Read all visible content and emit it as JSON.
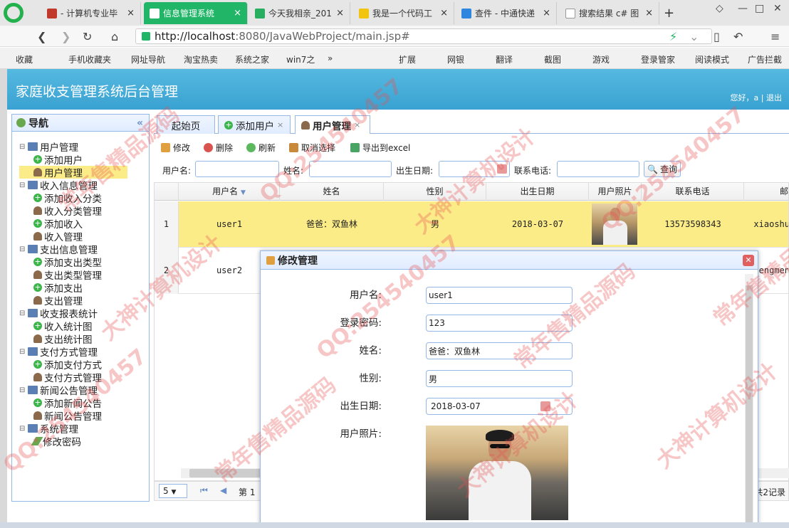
{
  "browser": {
    "tabs": [
      {
        "title": "- 计算机专业毕",
        "active": false
      },
      {
        "title": "信息管理系统",
        "active": true
      },
      {
        "title": "今天我相亲_201",
        "active": false
      },
      {
        "title": "我是一个代码工",
        "active": false
      },
      {
        "title": "查件 - 中通快递",
        "active": false
      },
      {
        "title": "搜索结果 c# 图",
        "active": false
      }
    ],
    "url_host": "http://localhost",
    "url_rest": ":8080/JavaWebProject/main.jsp#",
    "bookmarks": [
      "收藏",
      "手机收藏夹",
      "网址导航",
      "淘宝热卖",
      "系统之家",
      "win7之"
    ],
    "extensions": [
      "扩展",
      "网银",
      "翻译",
      "截图",
      "游戏",
      "登录管家",
      "阅读模式",
      "广告拦截"
    ]
  },
  "app": {
    "title": "家庭收支管理系统后台管理",
    "header_links": "您好，a  |  退出"
  },
  "sidebar": {
    "title": "导航",
    "groups": [
      {
        "label": "用户管理",
        "items": [
          {
            "label": "添加用户",
            "icon": "add"
          },
          {
            "label": "用户管理",
            "icon": "user",
            "selected": true
          }
        ]
      },
      {
        "label": "收入信息管理",
        "items": [
          {
            "label": "添加收入分类",
            "icon": "add"
          },
          {
            "label": "收入分类管理",
            "icon": "user"
          },
          {
            "label": "添加收入",
            "icon": "add"
          },
          {
            "label": "收入管理",
            "icon": "user"
          }
        ]
      },
      {
        "label": "支出信息管理",
        "items": [
          {
            "label": "添加支出类型",
            "icon": "add"
          },
          {
            "label": "支出类型管理",
            "icon": "user"
          },
          {
            "label": "添加支出",
            "icon": "add"
          },
          {
            "label": "支出管理",
            "icon": "user"
          }
        ]
      },
      {
        "label": "收支报表统计",
        "items": [
          {
            "label": "收入统计图",
            "icon": "add"
          },
          {
            "label": "支出统计图",
            "icon": "user"
          }
        ]
      },
      {
        "label": "支付方式管理",
        "items": [
          {
            "label": "添加支付方式",
            "icon": "add"
          },
          {
            "label": "支付方式管理",
            "icon": "user"
          }
        ]
      },
      {
        "label": "新闻公告管理",
        "items": [
          {
            "label": "添加新闻公告",
            "icon": "add"
          },
          {
            "label": "新闻公告管理",
            "icon": "user"
          }
        ]
      },
      {
        "label": "系统管理",
        "items": [
          {
            "label": "修改密码",
            "icon": "pen"
          }
        ]
      }
    ]
  },
  "tabs": [
    {
      "label": "起始页"
    },
    {
      "label": "添加用户"
    },
    {
      "label": "用户管理"
    }
  ],
  "toolbar": {
    "edit": "修改",
    "delete": "删除",
    "refresh": "刷新",
    "cancel_select": "取消选择",
    "export": "导出到excel"
  },
  "search": {
    "username_label": "用户名:",
    "name_label": "姓名:",
    "birth_label": "出生日期:",
    "phone_label": "联系电话:",
    "query": "查询"
  },
  "grid": {
    "columns": [
      "用户名",
      "姓名",
      "性别",
      "出生日期",
      "用户照片",
      "联系电话",
      "邮"
    ],
    "rows": [
      {
        "num": "1",
        "username": "user1",
        "name": "爸爸：双鱼林",
        "gender": "男",
        "birth": "2018-03-07",
        "phone": "13573598343",
        "email": "xiaoshu"
      },
      {
        "num": "2",
        "username": "user2",
        "name": "",
        "gender": "",
        "birth": "",
        "phone": "",
        "email": "hengmen"
      }
    ]
  },
  "pager": {
    "page_size": "5",
    "page_label": "第 1",
    "total": "共2记录"
  },
  "dialog": {
    "title": "修改管理",
    "fields": [
      {
        "label": "用户名:",
        "value": "user1"
      },
      {
        "label": "登录密码:",
        "value": "123"
      },
      {
        "label": "姓名:",
        "value": "爸爸：双鱼林"
      },
      {
        "label": "性别:",
        "value": "男"
      },
      {
        "label": "出生日期:",
        "value": "2018-03-07"
      }
    ],
    "photo_label": "用户照片:"
  },
  "watermark": {
    "texts": [
      "QQ:254540457",
      "大神计算机设计",
      "常年售精品源码"
    ]
  },
  "colors": {
    "header_blue": "#3aa2d2",
    "tab_green": "#21b567",
    "selected_row": "#fbec88",
    "panel_border": "#95b8e7"
  }
}
